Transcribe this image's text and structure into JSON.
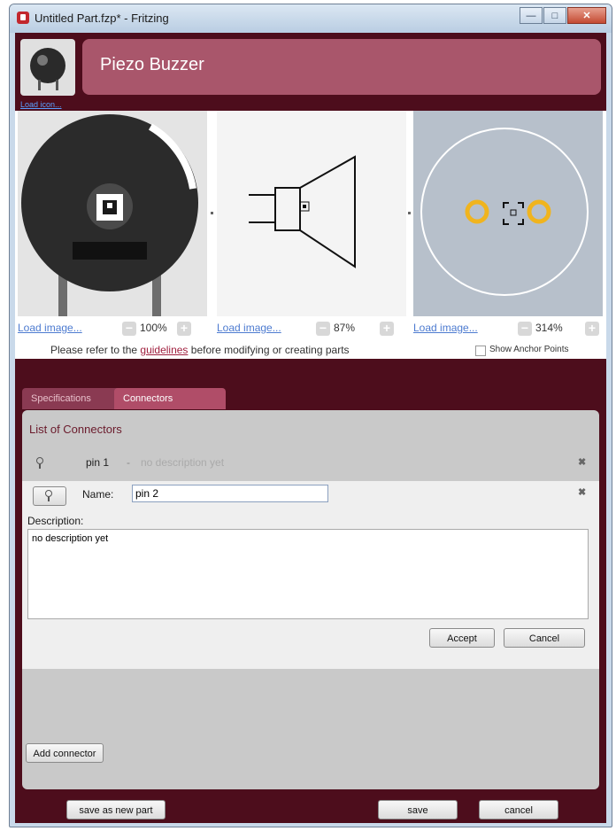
{
  "window": {
    "title": "Untitled Part.fzp* - Fritzing"
  },
  "header": {
    "part_title": "Piezo Buzzer",
    "load_icon": "Load icon..."
  },
  "views": [
    {
      "load_link": "Load image...",
      "zoom": "100%",
      "zoom_out": "−",
      "zoom_in": "+"
    },
    {
      "load_link": "Load image...",
      "zoom": "87%",
      "zoom_out": "−",
      "zoom_in": "+"
    },
    {
      "load_link": "Load image...",
      "zoom": "314%",
      "zoom_out": "−",
      "zoom_in": "+"
    }
  ],
  "guidelines": {
    "before": "Please refer to the ",
    "link": "guidelines",
    "after": " before modifying or creating parts",
    "anchor_label": "Show Anchor Points"
  },
  "tabs": [
    {
      "label": "Specifications",
      "active": false
    },
    {
      "label": "Connectors",
      "active": true
    }
  ],
  "connectors": {
    "list_title": "List of Connectors",
    "row": {
      "name": "pin 1",
      "dash": "-",
      "description": "no description yet"
    },
    "edit": {
      "name_label": "Name:",
      "name_value": "pin 2",
      "description_label": "Description:",
      "description_value": "no description yet",
      "accept_label": "Accept",
      "cancel_label": "Cancel"
    },
    "add_label": "Add connector"
  },
  "footer": {
    "save_new_label": "save as new part",
    "save_label": "save",
    "cancel_label": "cancel"
  },
  "colors": {
    "frame": "#4d0d1c",
    "title_panel": "#a9566b",
    "active_tab": "#b04d68",
    "pad_ring": "#f0b41e"
  }
}
